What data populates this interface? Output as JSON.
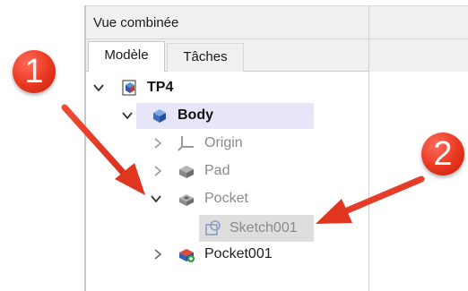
{
  "panel": {
    "title": "Vue combinée",
    "tabs": [
      {
        "label": "Modèle",
        "active": true
      },
      {
        "label": "Tâches",
        "active": false
      }
    ]
  },
  "tree": {
    "document": {
      "label": "TP4",
      "expanded": true,
      "icon": "document-icon"
    },
    "body": {
      "label": "Body",
      "expanded": true,
      "icon": "body-icon"
    },
    "children": [
      {
        "label": "Origin",
        "expanded": false,
        "icon": "origin-icon"
      },
      {
        "label": "Pad",
        "expanded": false,
        "icon": "pad-icon"
      },
      {
        "label": "Pocket",
        "expanded": true,
        "icon": "pocket-icon"
      },
      {
        "label": "Sketch001",
        "icon": "sketch-icon",
        "selected": true
      },
      {
        "label": "Pocket001",
        "expanded": false,
        "icon": "pocket001-icon"
      }
    ]
  },
  "annotations": {
    "badge1": "1",
    "badge2": "2",
    "color": "#e8361f"
  }
}
